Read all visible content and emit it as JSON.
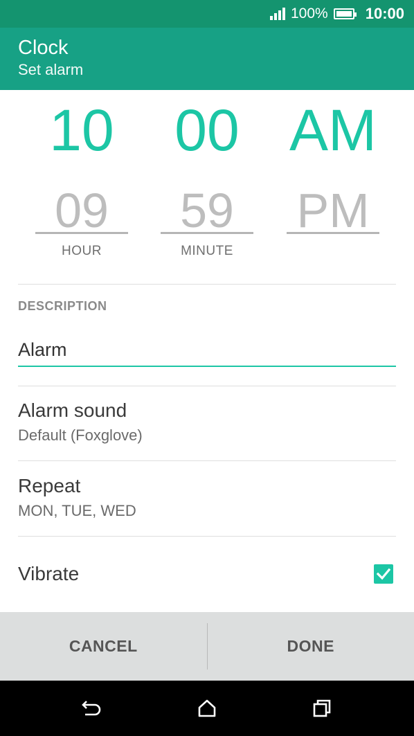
{
  "status_bar": {
    "battery_percent": "100%",
    "time": "10:00",
    "icons": [
      "signal-icon",
      "battery-icon"
    ]
  },
  "app_bar": {
    "title": "Clock",
    "subtitle": "Set alarm"
  },
  "time_picker": {
    "hour": {
      "selected": "10",
      "previous": "09",
      "label": "HOUR"
    },
    "minute": {
      "selected": "00",
      "previous": "59",
      "label": "MINUTE"
    },
    "ampm": {
      "selected": "AM",
      "previous": "PM"
    }
  },
  "description": {
    "label": "DESCRIPTION",
    "value": "Alarm"
  },
  "alarm_sound": {
    "title": "Alarm sound",
    "value": "Default (Foxglove)"
  },
  "repeat": {
    "title": "Repeat",
    "value": "MON, TUE, WED"
  },
  "vibrate": {
    "title": "Vibrate",
    "checked": true
  },
  "actions": {
    "cancel_label": "CANCEL",
    "done_label": "DONE"
  },
  "nav_bar": {
    "icons": [
      "back-icon",
      "home-icon",
      "recents-icon"
    ]
  },
  "colors": {
    "status_bar": "#14946f",
    "app_bar": "#17a185",
    "accent": "#1cc6a5",
    "action_bar": "#dcdede"
  }
}
